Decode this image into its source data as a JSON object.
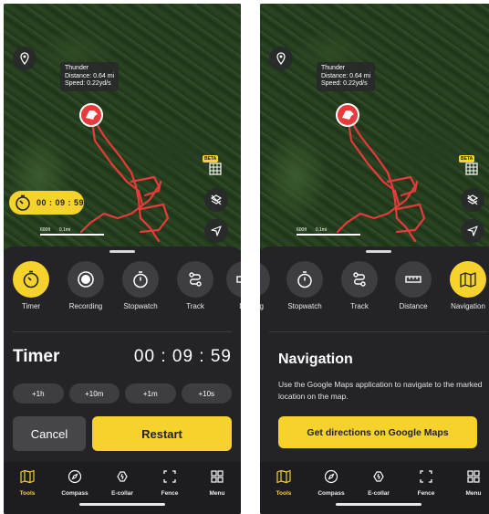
{
  "colors": {
    "accent": "#f5d22c",
    "track": "#e83a3a",
    "sheet": "#242428"
  },
  "map": {
    "tooltip": {
      "name": "Thunder",
      "distance": "Distance: 0.64 mi",
      "speed": "Speed: 0.22yd/s"
    },
    "beta": "BETA",
    "scale_left": "600ft",
    "scale_right": "0.1mi"
  },
  "left": {
    "timer_pill": "00 : 09 : 59",
    "tools": [
      {
        "label": "Timer",
        "icon": "timer-icon"
      },
      {
        "label": "Recording",
        "icon": "record-icon"
      },
      {
        "label": "Stopwatch",
        "icon": "stopwatch-icon"
      },
      {
        "label": "Track",
        "icon": "track-icon"
      },
      {
        "label": "Dis",
        "icon": "distance-icon"
      }
    ],
    "title": "Timer",
    "time": "00 : 09 : 59",
    "increments": [
      "+1h",
      "+10m",
      "+1m",
      "+10s"
    ],
    "cancel": "Cancel",
    "restart": "Restart"
  },
  "right": {
    "tools": [
      {
        "label": "ng",
        "icon": "recording-icon"
      },
      {
        "label": "Stopwatch",
        "icon": "stopwatch-icon"
      },
      {
        "label": "Track",
        "icon": "track-icon"
      },
      {
        "label": "Distance",
        "icon": "ruler-icon"
      },
      {
        "label": "Navigation",
        "icon": "navigation-map-icon"
      }
    ],
    "title": "Navigation",
    "description": "Use the Google Maps application to navigate to the marked location on the map.",
    "button": "Get directions on Google Maps"
  },
  "tabbar": [
    {
      "label": "Tools",
      "icon": "map-tools-icon",
      "active": true
    },
    {
      "label": "Compass",
      "icon": "compass-icon",
      "active": false
    },
    {
      "label": "E-collar",
      "icon": "e-collar-icon",
      "active": false
    },
    {
      "label": "Fence",
      "icon": "fence-icon",
      "active": false
    },
    {
      "label": "Menu",
      "icon": "menu-grid-icon",
      "active": false
    }
  ]
}
